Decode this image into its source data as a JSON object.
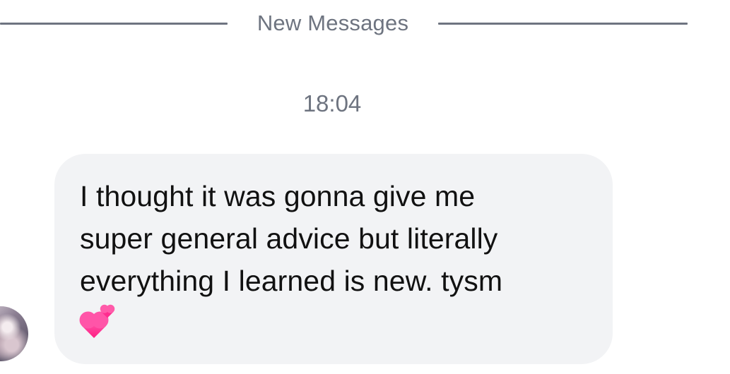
{
  "divider": {
    "label": "New Messages"
  },
  "timestamp": "18:04",
  "message": {
    "text": "I thought it was gonna give me\nsuper general advice but literally\neverything I learned is new. tysm",
    "emoji": "two-hearts-icon"
  },
  "colors": {
    "bubble_bg": "#f2f3f5",
    "meta_text": "#6e7480",
    "message_text": "#111111",
    "heart_pink": "#ff2d8f"
  }
}
